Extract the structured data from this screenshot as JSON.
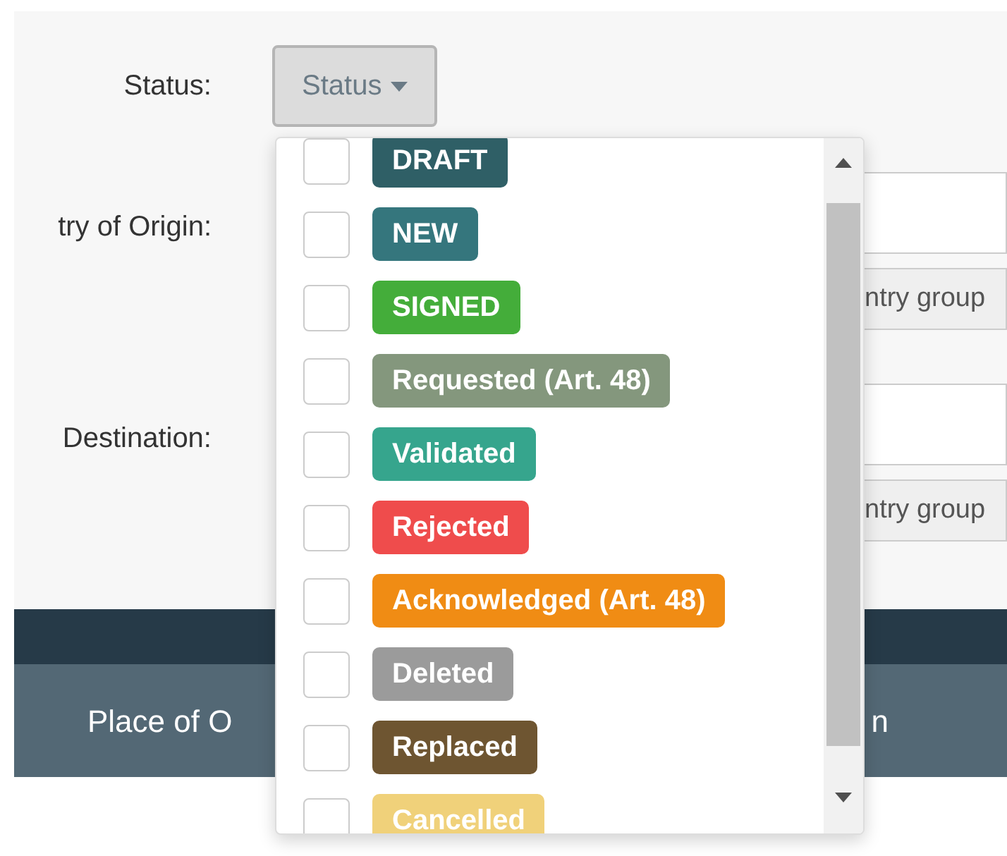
{
  "filters": [
    {
      "label": "Status:",
      "kind": "button",
      "button": "Status"
    },
    {
      "label": "try of Origin:",
      "kind": "country",
      "group_button": "ntry group"
    },
    {
      "label": "Destination:",
      "kind": "country",
      "group_button": "ntry group"
    }
  ],
  "status_dropdown": {
    "items": [
      {
        "label": "DRAFT",
        "color": "#2f5f66",
        "checked": false
      },
      {
        "label": "NEW",
        "color": "#35767d",
        "checked": false
      },
      {
        "label": "SIGNED",
        "color": "#44ad3a",
        "checked": false
      },
      {
        "label": "Requested (Art. 48)",
        "color": "#84977d",
        "checked": false
      },
      {
        "label": "Validated",
        "color": "#36a58d",
        "checked": false
      },
      {
        "label": "Rejected",
        "color": "#ef4c4c",
        "checked": false
      },
      {
        "label": "Acknowledged (Art. 48)",
        "color": "#f08c14",
        "checked": false
      },
      {
        "label": "Deleted",
        "color": "#9b9b9b",
        "checked": false
      },
      {
        "label": "Replaced",
        "color": "#6e5531",
        "checked": false
      },
      {
        "label": "Cancelled",
        "color": "#f0d17a",
        "checked": false
      }
    ]
  },
  "table": {
    "columns": [
      "Place of O",
      "n"
    ]
  }
}
